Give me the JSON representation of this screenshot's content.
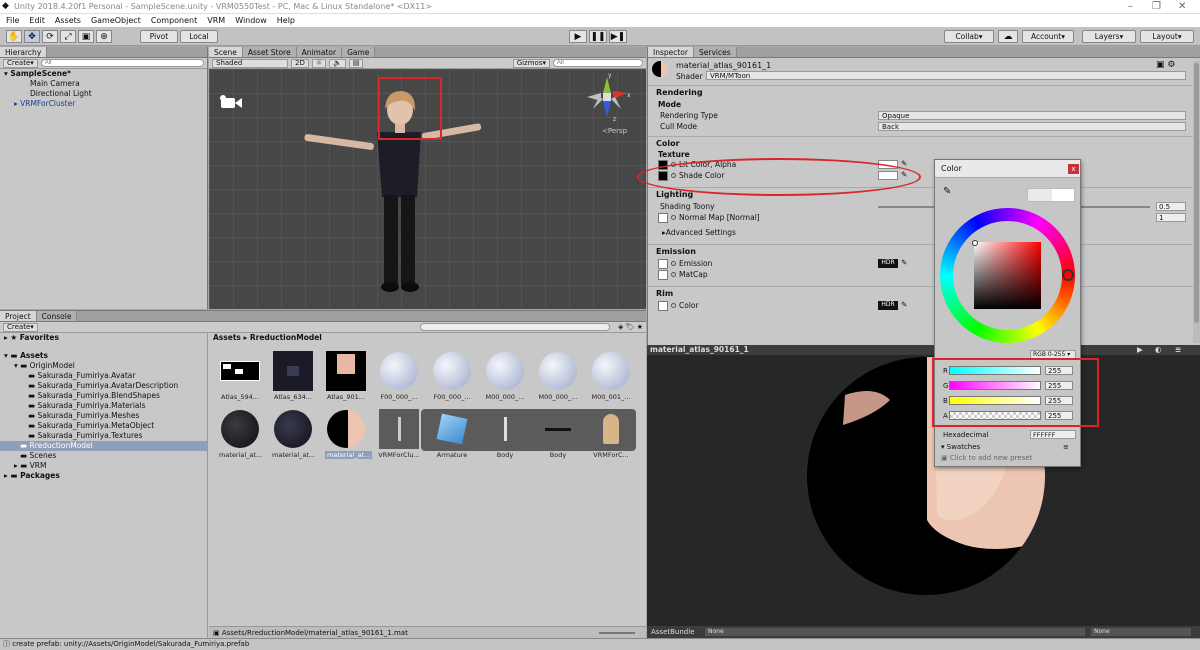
{
  "window": {
    "title": "Unity 2018.4.20f1 Personal - SampleScene.unity - VRM0550Test - PC, Mac & Linux Standalone* <DX11>"
  },
  "menu": [
    "File",
    "Edit",
    "Assets",
    "GameObject",
    "Component",
    "VRM",
    "Window",
    "Help"
  ],
  "toolbar": {
    "pivot": "Pivot",
    "local": "Local",
    "collab": "Collab",
    "account": "Account",
    "layers": "Layers",
    "layout": "Layout"
  },
  "hierarchy": {
    "tab": "Hierarchy",
    "create": "Create",
    "search_placeholder": "All",
    "scene": "SampleScene*",
    "items": [
      "Main Camera",
      "Directional Light",
      "VRMForCluster"
    ]
  },
  "scene": {
    "tabs": [
      "Scene",
      "Asset Store",
      "Animator",
      "Game"
    ],
    "shading": "Shaded",
    "mode2d": "2D",
    "gizmos": "Gizmos",
    "search_placeholder": "All",
    "persp": "Persp"
  },
  "project": {
    "tabs": [
      "Project",
      "Console"
    ],
    "create": "Create",
    "favorites": "Favorites",
    "assets": "Assets",
    "folders": [
      "OriginModel",
      "Sakurada_Fumiriya.Avatar",
      "Sakurada_Fumiriya.AvatarDescription",
      "Sakurada_Fumiriya.BlendShapes",
      "Sakurada_Fumiriya.Materials",
      "Sakurada_Fumiriya.Meshes",
      "Sakurada_Fumiriya.MetaObject",
      "Sakurada_Fumiriya.Textures",
      "RreductionModel",
      "Scenes",
      "VRM"
    ],
    "packages": "Packages",
    "breadcrumb_root": "Assets",
    "breadcrumb_cur": "RreductionModel",
    "row1": [
      "Atlas_594...",
      "Atlas_634...",
      "Atlas_901...",
      "F00_000_...",
      "F00_000_...",
      "M00_000_...",
      "M00_000_...",
      "M00_001_..."
    ],
    "row2": [
      "material_at...",
      "material_at...",
      "material_at...",
      "VRMForClu...",
      "Armature",
      "Body",
      "Body",
      "VRMForC..."
    ],
    "footer_path": "Assets/RreductionModel/material_atlas_90161_1.mat"
  },
  "inspector": {
    "tabs": [
      "Inspector",
      "Services"
    ],
    "material_name": "material_atlas_90161_1",
    "shader_label": "Shader",
    "shader": "VRM/MToon",
    "rendering": "Rendering",
    "mode": "Mode",
    "rendering_type": "Rendering Type",
    "rendering_type_val": "Opaque",
    "cull_mode": "Cull Mode",
    "cull_mode_val": "Back",
    "color": "Color",
    "texture": "Texture",
    "lit_color": "Lit Color, Alpha",
    "shade_color": "Shade Color",
    "lighting": "Lighting",
    "shading_toony": "Shading Toony",
    "shading_toony_val": "0.5",
    "normal_map": "Normal Map [Normal]",
    "normal_map_val": "1",
    "advanced": "Advanced Settings",
    "emission": "Emission",
    "emission_item": "Emission",
    "matcap": "MatCap",
    "hdr": "HDR",
    "rim": "Rim",
    "rim_color": "Color"
  },
  "preview": {
    "title": "material_atlas_90161_1",
    "assetbundle": "AssetBundle",
    "none1": "None",
    "none2": "None"
  },
  "color_picker": {
    "title": "Color",
    "close": "x",
    "mode": "RGB 0-255",
    "channels": [
      {
        "label": "R",
        "value": "255"
      },
      {
        "label": "G",
        "value": "255"
      },
      {
        "label": "B",
        "value": "255"
      },
      {
        "label": "A",
        "value": "255"
      }
    ],
    "hex_label": "Hexadecimal",
    "hex_value": "FFFFFF",
    "swatches": "Swatches",
    "swatch_hint": "Click to add new preset"
  },
  "status": {
    "text": "create prefab: unity://Assets/OriginModel/Sakurada_Fumiriya.prefab"
  }
}
